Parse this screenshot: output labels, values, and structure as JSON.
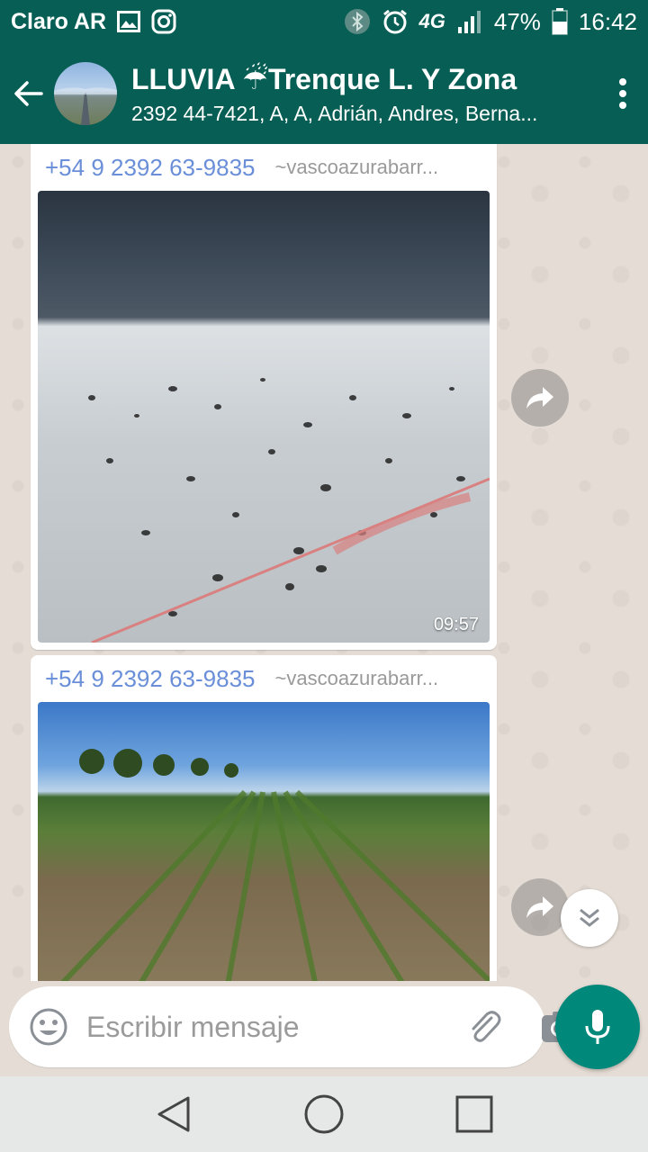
{
  "status_bar": {
    "carrier": "Claro AR",
    "network": "4G",
    "battery": "47%",
    "time": "16:42",
    "icons": [
      "image-icon",
      "instagram-icon",
      "bluetooth-icon",
      "alarm-icon",
      "network-4g-icon",
      "signal-icon",
      "battery-icon"
    ]
  },
  "header": {
    "title": "LLUVIA ☔Trenque L. Y Zona",
    "subtitle": "2392 44-7421, A, A, Adrián, Andres, Berna..."
  },
  "messages": [
    {
      "sender_phone": "+54 9 2392 63-9835",
      "sender_name": "~vascoazurabarr...",
      "type": "image",
      "time": "09:57"
    },
    {
      "sender_phone": "+54 9 2392 63-9835",
      "sender_name": "~vascoazurabarr...",
      "type": "image"
    }
  ],
  "composer": {
    "placeholder": "Escribir mensaje"
  },
  "colors": {
    "header": "#075e54",
    "accent": "#00897b",
    "sender": "#6a8fd8",
    "chat_bg": "#e5ddd5"
  }
}
